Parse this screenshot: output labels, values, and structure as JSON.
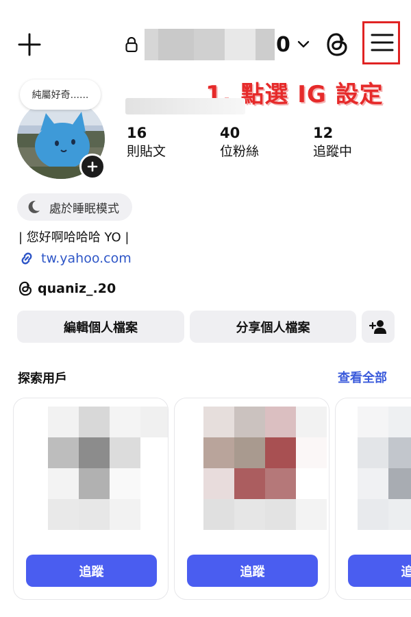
{
  "header": {
    "username_suffix": "0",
    "annotation": "1. 點選 IG 設定",
    "add_icon": "plus-icon",
    "lock_icon": "lock-icon",
    "threads_icon": "threads-icon",
    "menu_icon": "hamburger-menu-icon"
  },
  "profile": {
    "note": "純屬好奇......",
    "stats": [
      {
        "value": "16",
        "label": "則貼文"
      },
      {
        "value": "40",
        "label": "位粉絲"
      },
      {
        "value": "12",
        "label": "追蹤中"
      }
    ],
    "status_chip": "處於睡眠模式",
    "bio": "| 您好啊哈哈哈 YO |",
    "link": "tw.yahoo.com",
    "threads_handle": "quaniz_.20"
  },
  "actions": {
    "edit_profile": "編輯個人檔案",
    "share_profile": "分享個人檔案"
  },
  "discover": {
    "title": "探索用戶",
    "see_all": "查看全部",
    "follow_label": "追蹤"
  },
  "colors": {
    "accent": "#4a5df0",
    "link": "#2e56c7",
    "annotation": "#e62a2a"
  }
}
